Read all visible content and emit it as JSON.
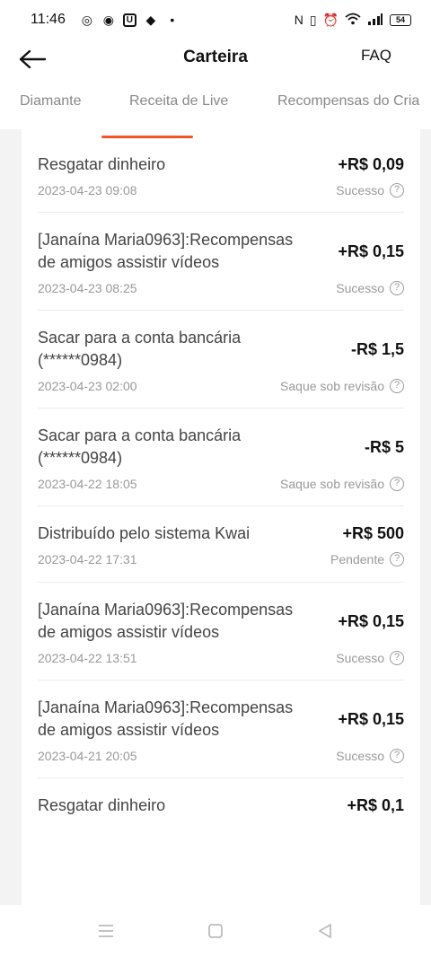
{
  "statusbar": {
    "time": "11:46",
    "battery": "54"
  },
  "header": {
    "title": "Carteira",
    "faq": "FAQ"
  },
  "tabs": [
    {
      "label": "Diamante"
    },
    {
      "label": "Receita de Live"
    },
    {
      "label": "Recompensas do Cria"
    }
  ],
  "transactions": [
    {
      "desc": "Resgatar dinheiro",
      "amount": "+R$ 0,09",
      "date": "2023-04-23 09:08",
      "status": "Sucesso"
    },
    {
      "desc": "[Janaína Maria0963]:Recompensas de amigos assistir vídeos",
      "amount": "+R$ 0,15",
      "date": "2023-04-23 08:25",
      "status": "Sucesso"
    },
    {
      "desc": "Sacar para a conta bancária (******0984)",
      "amount": "-R$ 1,5",
      "date": "2023-04-23 02:00",
      "status": "Saque sob revisão"
    },
    {
      "desc": "Sacar para a conta bancária (******0984)",
      "amount": "-R$ 5",
      "date": "2023-04-22 18:05",
      "status": "Saque sob revisão"
    },
    {
      "desc": "Distribuído pelo sistema Kwai",
      "amount": "+R$ 500",
      "date": "2023-04-22 17:31",
      "status": "Pendente"
    },
    {
      "desc": "[Janaína Maria0963]:Recompensas de amigos assistir vídeos",
      "amount": "+R$ 0,15",
      "date": "2023-04-22 13:51",
      "status": "Sucesso"
    },
    {
      "desc": "[Janaína Maria0963]:Recompensas de amigos assistir vídeos",
      "amount": "+R$ 0,15",
      "date": "2023-04-21 20:05",
      "status": "Sucesso"
    },
    {
      "desc": "Resgatar dinheiro",
      "amount": "+R$ 0,1",
      "date": "",
      "status": ""
    }
  ],
  "colors": {
    "accent": "#f0552b"
  }
}
